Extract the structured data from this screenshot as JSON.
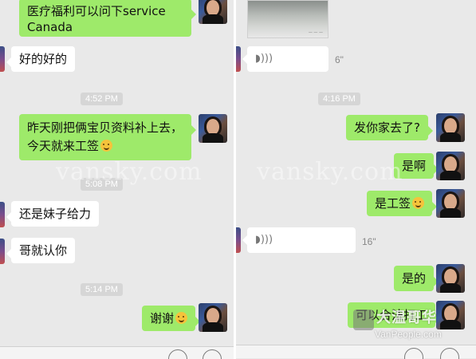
{
  "left_chat": {
    "messages": [
      {
        "text": "医疗福利可以问下service Canada"
      },
      {
        "text": "好的好的"
      },
      {
        "time": "4:52 PM"
      },
      {
        "text": "昨天刚把俩宝贝资料补上去，今天就来工签"
      },
      {
        "time": "5:08 PM"
      },
      {
        "text": "还是妹子给力"
      },
      {
        "text": "哥就认你"
      },
      {
        "time": "5:14 PM"
      },
      {
        "text": "谢谢"
      }
    ]
  },
  "right_chat": {
    "messages": [
      {
        "duration": "6\""
      },
      {
        "time": "4:16 PM"
      },
      {
        "text": "发你家去了?"
      },
      {
        "text": "是啊"
      },
      {
        "text": "是工签"
      },
      {
        "duration": "16\""
      },
      {
        "text": "是的"
      },
      {
        "text": "可以合法打工"
      }
    ]
  },
  "watermark": {
    "text": "vansky.com",
    "logo_text": "大温哥华",
    "logo_url": "VanPeople.com"
  }
}
